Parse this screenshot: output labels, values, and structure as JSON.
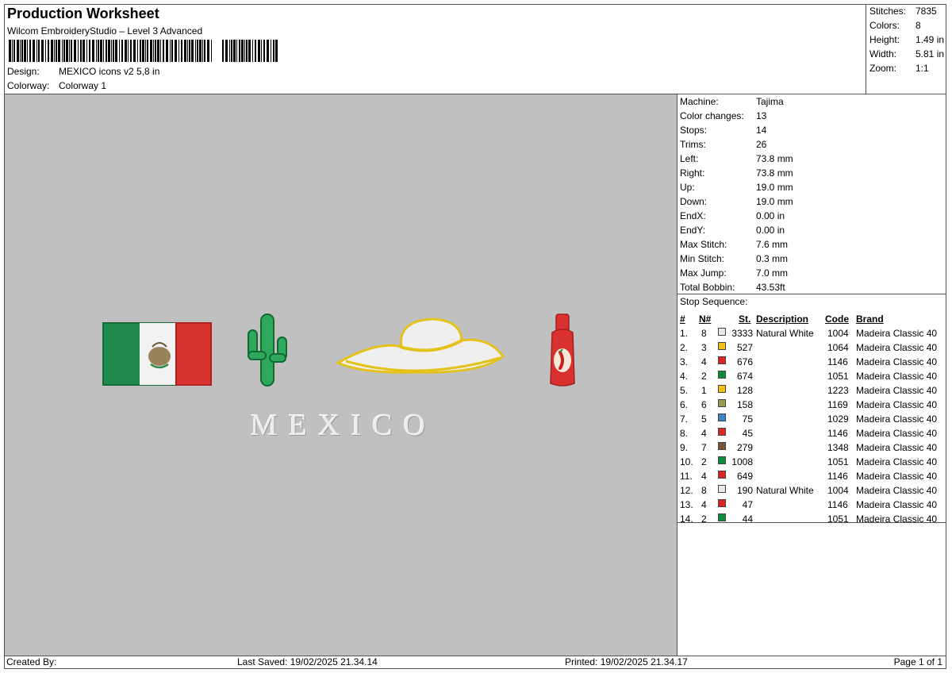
{
  "header": {
    "title": "Production Worksheet",
    "subtitle": "Wilcom EmbroideryStudio – Level 3 Advanced",
    "design_label": "Design:",
    "design_value": "MEXICO icons v2 5,8 in",
    "colorway_label": "Colorway:",
    "colorway_value": "Colorway 1"
  },
  "stats": [
    {
      "label": "Stitches:",
      "value": "7835"
    },
    {
      "label": "Colors:",
      "value": "8"
    },
    {
      "label": "Height:",
      "value": "1.49 in"
    },
    {
      "label": "Width:",
      "value": "5.81 in"
    },
    {
      "label": "Zoom:",
      "value": "1:1"
    }
  ],
  "machine_info": [
    {
      "label": "Machine:",
      "value": "Tajima"
    },
    {
      "label": "Color changes:",
      "value": "13"
    },
    {
      "label": "Stops:",
      "value": "14"
    },
    {
      "label": "Trims:",
      "value": "26"
    },
    {
      "label": "Left:",
      "value": "73.8 mm"
    },
    {
      "label": "Right:",
      "value": "73.8 mm"
    },
    {
      "label": "Up:",
      "value": "19.0 mm"
    },
    {
      "label": "Down:",
      "value": "19.0 mm"
    },
    {
      "label": "EndX:",
      "value": "0.00 in"
    },
    {
      "label": "EndY:",
      "value": "0.00 in"
    },
    {
      "label": "Max Stitch:",
      "value": "7.6 mm"
    },
    {
      "label": "Min Stitch:",
      "value": "0.3 mm"
    },
    {
      "label": "Max Jump:",
      "value": "7.0 mm"
    },
    {
      "label": "Total Bobbin:",
      "value": "43.53ft"
    }
  ],
  "stop_sequence": {
    "title": "Stop Sequence:",
    "columns": {
      "num": "#",
      "n": "N#",
      "st": "St.",
      "desc": "Description",
      "code": "Code",
      "brand": "Brand"
    },
    "rows": [
      {
        "num": "1.",
        "n": "8",
        "color": "#e8e8e8",
        "st": "3333",
        "desc": "Natural White",
        "code": "1004",
        "brand": "Madeira Classic 40"
      },
      {
        "num": "2.",
        "n": "3",
        "color": "#f2c21c",
        "st": "527",
        "desc": "",
        "code": "1064",
        "brand": "Madeira Classic 40"
      },
      {
        "num": "3.",
        "n": "4",
        "color": "#d92525",
        "st": "676",
        "desc": "",
        "code": "1146",
        "brand": "Madeira Classic 40"
      },
      {
        "num": "4.",
        "n": "2",
        "color": "#118a3c",
        "st": "674",
        "desc": "",
        "code": "1051",
        "brand": "Madeira Classic 40"
      },
      {
        "num": "5.",
        "n": "1",
        "color": "#f2c21c",
        "st": "128",
        "desc": "",
        "code": "1223",
        "brand": "Madeira Classic 40"
      },
      {
        "num": "6.",
        "n": "6",
        "color": "#9a9a52",
        "st": "158",
        "desc": "",
        "code": "1169",
        "brand": "Madeira Classic 40"
      },
      {
        "num": "7.",
        "n": "5",
        "color": "#3a86c8",
        "st": "75",
        "desc": "",
        "code": "1029",
        "brand": "Madeira Classic 40"
      },
      {
        "num": "8.",
        "n": "4",
        "color": "#d92525",
        "st": "45",
        "desc": "",
        "code": "1146",
        "brand": "Madeira Classic 40"
      },
      {
        "num": "9.",
        "n": "7",
        "color": "#7a5638",
        "st": "279",
        "desc": "",
        "code": "1348",
        "brand": "Madeira Classic 40"
      },
      {
        "num": "10.",
        "n": "2",
        "color": "#118a3c",
        "st": "1008",
        "desc": "",
        "code": "1051",
        "brand": "Madeira Classic 40"
      },
      {
        "num": "11.",
        "n": "4",
        "color": "#d92525",
        "st": "649",
        "desc": "",
        "code": "1146",
        "brand": "Madeira Classic 40"
      },
      {
        "num": "12.",
        "n": "8",
        "color": "#e8e8e8",
        "st": "190",
        "desc": "Natural White",
        "code": "1004",
        "brand": "Madeira Classic 40"
      },
      {
        "num": "13.",
        "n": "4",
        "color": "#d92525",
        "st": "47",
        "desc": "",
        "code": "1146",
        "brand": "Madeira Classic 40"
      },
      {
        "num": "14.",
        "n": "2",
        "color": "#118a3c",
        "st": "44",
        "desc": "",
        "code": "1051",
        "brand": "Madeira Classic 40"
      }
    ]
  },
  "design_text": "MEXICO",
  "footer": {
    "created_by": "Created By:",
    "last_saved": "Last Saved: 19/02/2025 21.34.14",
    "printed": "Printed: 19/02/2025 21.34.17",
    "page": "Page 1 of 1"
  }
}
